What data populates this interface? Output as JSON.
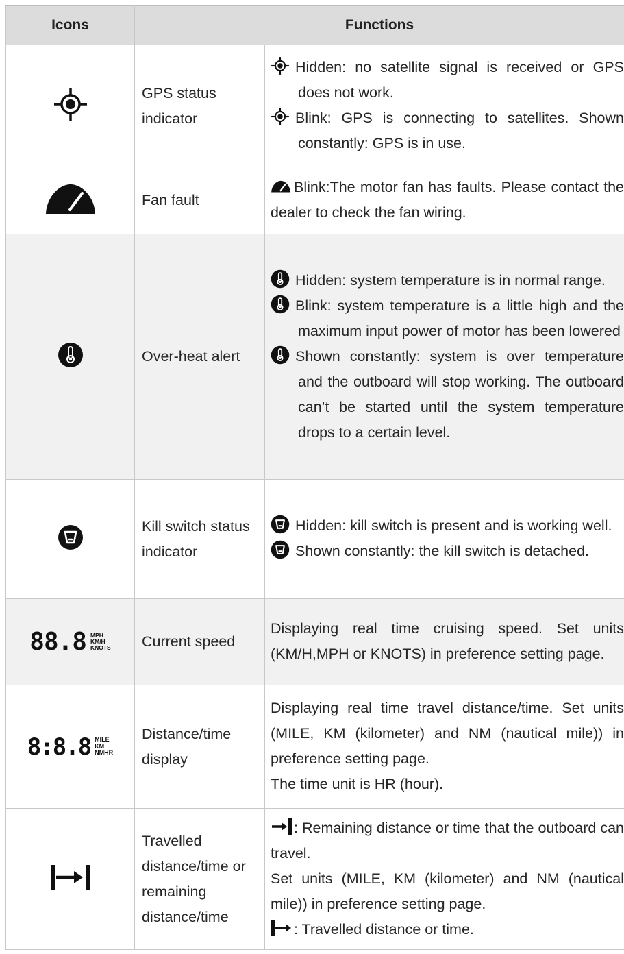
{
  "header": {
    "icons_label": "Icons",
    "functions_label": "Functions"
  },
  "rows": [
    {
      "icon": "gps-crosshair-icon",
      "name": "GPS status indicator",
      "lines": [
        "Hidden: no satellite signal is received or GPS does not work.",
        "Blink: GPS is connecting to satellites. Shown constantly: GPS is in use."
      ]
    },
    {
      "icon": "fan-gauge-icon",
      "name": "Fan fault",
      "lines": [
        "Blink:The motor fan has faults. Please contact the dealer to check the fan wiring."
      ]
    },
    {
      "icon": "thermometer-icon",
      "name": "Over-heat alert",
      "lines": [
        "Hidden: system temperature is in normal range.",
        "Blink: system temperature is a little high and the maximum input power of motor has been lowered",
        "Shown constantly: system is over temperature and the outboard will stop working. The outboard can’t be started until the system temperature drops to a certain level."
      ]
    },
    {
      "icon": "kill-switch-icon",
      "name": "Kill switch status indicator",
      "lines": [
        "Hidden: kill switch is present and is working well.",
        "Shown constantly: the kill switch is detached."
      ]
    },
    {
      "icon": "speed-display-icon",
      "icon_digits": "88.8",
      "icon_units": [
        "MPH",
        "KM/H",
        "KNOTS"
      ],
      "name": "Current speed",
      "lines": [
        "Displaying real time cruising speed. Set units (KM/H,MPH or KNOTS) in preference setting page."
      ]
    },
    {
      "icon": "distance-time-display-icon",
      "icon_digits": "8:8.8",
      "icon_units": [
        "MILE",
        "KM",
        "NMHR"
      ],
      "name": "Distance/time display",
      "lines": [
        "Displaying real time travel distance/time. Set units (MILE, KM (kilometer) and NM (nautical mile)) in preference setting page.",
        "The time unit is HR (hour)."
      ]
    },
    {
      "icon": "bar-arrow-bar-icon",
      "name": "Travelled distance/time or remaining distance/time",
      "lines": [
        ": Remaining distance or time that the outboard can travel.",
        "Set units (MILE, KM (kilometer) and NM (nautical mile)) in preference setting page.",
        ": Travelled distance or time."
      ]
    }
  ]
}
